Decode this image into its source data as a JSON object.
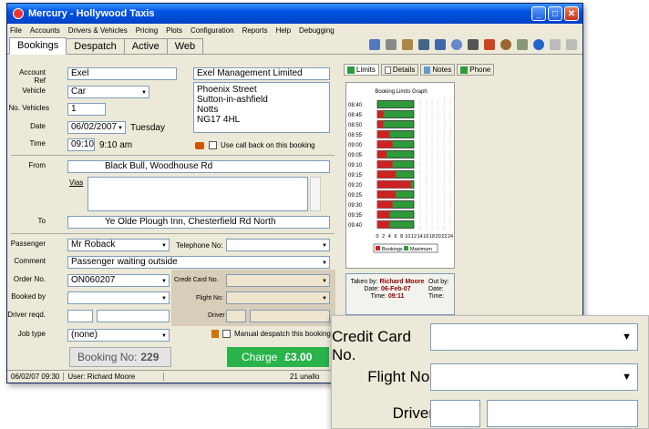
{
  "window": {
    "title": "Mercury - Hollywood Taxis"
  },
  "menu": [
    "File",
    "Accounts",
    "Drivers & Vehicles",
    "Pricing",
    "Plots",
    "Configuration",
    "Reports",
    "Help",
    "Debugging"
  ],
  "tabs": [
    "Bookings",
    "Despatch",
    "Active",
    "Web"
  ],
  "side_tabs": [
    "Limits",
    "Details",
    "Notes",
    "Phone"
  ],
  "form": {
    "account_ref_label": "Account Ref",
    "account_ref": "Exel",
    "vehicle_label": "Vehicle",
    "vehicle": "Car",
    "no_vehicles_label": "No. Vehicles",
    "no_vehicles": "1",
    "date_label": "Date",
    "date": "06/02/2007",
    "weekday": "Tuesday",
    "time_label": "Time",
    "time": "09:10",
    "time_text": "9:10 am",
    "company": "Exel Management Limited",
    "address": [
      "Phoenix Street",
      "Sutton-in-ashfield",
      "Notts",
      "NG17 4HL"
    ],
    "callback_label": "Use call back on this booking",
    "from_label": "From",
    "from": "Black Bull, Woodhouse Rd",
    "vias_label": "Vias",
    "to_label": "To",
    "to": "Ye Olde Plough Inn, Chesterfield Rd North",
    "passenger_label": "Passenger",
    "passenger": "Mr Roback",
    "telephone_label": "Telephone No:",
    "comment_label": "Comment",
    "comment": "Passenger waiting outside",
    "order_label": "Order No.",
    "order": "ON060207",
    "booked_by_label": "Booked by",
    "driver_reqd_label": "Driver reqd.",
    "job_type_label": "Job type",
    "job_type": "(none)",
    "credit_card_label": "Credit Card No.",
    "flight_label": "Flight No:",
    "driver_label": "Driver",
    "manual_label": "Manual despatch this booking",
    "booking_no_label": "Booking No:",
    "booking_no": "229",
    "charge_label": "Charge",
    "charge": "£3.00"
  },
  "info": {
    "taken_by_label": "Taken by:",
    "taken_by": "Richard Moore",
    "date_label": "Date:",
    "date": "06-Feb-07",
    "time_label": "Time:",
    "time": "09:11",
    "out_by_label": "Out by:",
    "out_date_label": "Date:",
    "out_time_label": "Time:"
  },
  "status": {
    "left": "06/02/07  09:30",
    "user": "User: Richard Moore",
    "right": "21 unallo"
  },
  "zoom": {
    "credit_card_label": "Credit Card No.",
    "flight_label": "Flight No:",
    "driver_label": "Driver"
  },
  "chart_data": {
    "type": "bar",
    "title": "Booking Limits Graph",
    "categories": [
      "08:40",
      "08:45",
      "08:50",
      "08:55",
      "09:00",
      "09:05",
      "09:10",
      "09:15",
      "09:20",
      "09:25",
      "09:30",
      "09:35",
      "09:40"
    ],
    "series": [
      {
        "name": "Bookings",
        "color": "#cc2222",
        "values": [
          0,
          2,
          2,
          4,
          5,
          3,
          5,
          6,
          11,
          6,
          5,
          4,
          4
        ]
      },
      {
        "name": "Maximum",
        "color": "#2e9a3a",
        "values": [
          12,
          12,
          12,
          12,
          12,
          12,
          12,
          12,
          12,
          12,
          12,
          12,
          12
        ]
      }
    ],
    "xticks": [
      0,
      2,
      4,
      6,
      8,
      10,
      12,
      14,
      16,
      18,
      20,
      22,
      24
    ],
    "xlim": [
      0,
      24
    ],
    "grid": true,
    "legend": "bottom"
  }
}
